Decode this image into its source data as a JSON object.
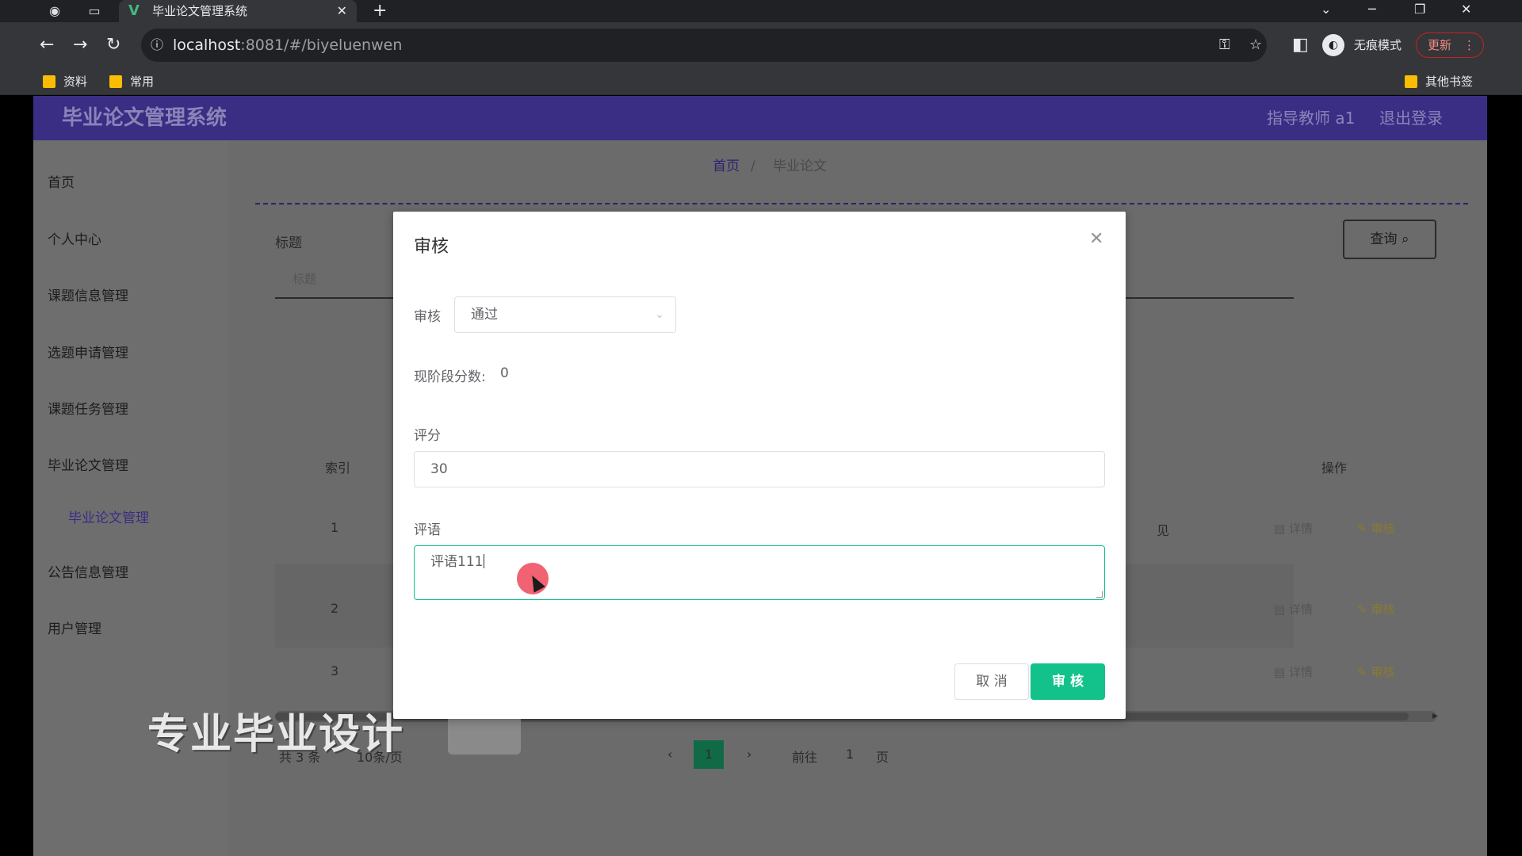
{
  "browser": {
    "tab_title": "毕业论文管理系统",
    "tab_close": "✕",
    "new_tab": "+",
    "url_host": "localhost",
    "url_path": ":8081/#/biyeluenwen",
    "incognito_label": "无痕模式",
    "update_label": "更新",
    "bookmarks": [
      "资料",
      "常用"
    ],
    "other_bookmarks": "其他书签"
  },
  "app": {
    "title": "毕业论文管理系统",
    "user": "指导教师 a1",
    "logout": "退出登录"
  },
  "sidebar": {
    "items": [
      "首页",
      "个人中心",
      "课题信息管理",
      "选题申请管理",
      "课题任务管理",
      "毕业论文管理"
    ],
    "sub_item": "毕业论文管理",
    "items_after": [
      "公告信息管理",
      "用户管理"
    ]
  },
  "breadcrumb": {
    "home": "首页",
    "current": "毕业论文"
  },
  "search": {
    "label": "标题",
    "placeholder": "标题",
    "button": "查询"
  },
  "table": {
    "headers": {
      "index": "索引",
      "ops": "操作"
    },
    "rows": [
      {
        "index": "1",
        "frag": "见"
      },
      {
        "index": "2",
        "frag": ""
      },
      {
        "index": "3",
        "frag": ""
      }
    ],
    "op_detail": "详情",
    "op_audit": "审核"
  },
  "pager": {
    "total": "共 3 条",
    "size": "10条/页",
    "current": "1",
    "goto": "前往",
    "goto_page": "1",
    "unit": "页"
  },
  "watermark": "专业毕业设计",
  "dialog": {
    "title": "审核",
    "audit_label": "审核",
    "audit_value": "通过",
    "stage_score_label": "现阶段分数:",
    "stage_score_value": "0",
    "score_label": "评分",
    "score_value": "30",
    "comment_label": "评语",
    "comment_value": "评语111",
    "cancel": "取 消",
    "submit": "审 核"
  }
}
